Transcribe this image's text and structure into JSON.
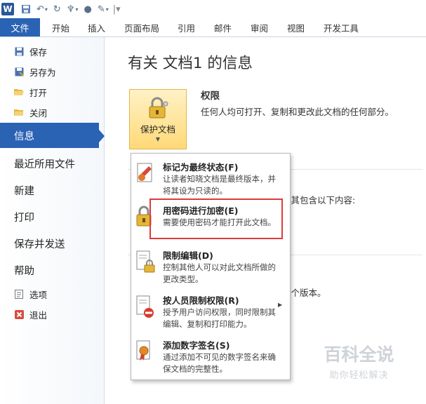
{
  "app": {
    "logo_letter": "W"
  },
  "quick_access": {
    "icons": [
      "save-icon",
      "undo-icon",
      "redo-icon",
      "format-painter-icon",
      "bullet-icon",
      "draw-icon",
      "customize-icon"
    ]
  },
  "ribbon": {
    "file_tab": "文件",
    "tabs": [
      "开始",
      "插入",
      "页面布局",
      "引用",
      "邮件",
      "审阅",
      "视图",
      "开发工具"
    ]
  },
  "sidebar": {
    "save": "保存",
    "save_as": "另存为",
    "open": "打开",
    "close": "关闭",
    "info": "信息",
    "recent": "最近所用文件",
    "new": "新建",
    "print": "打印",
    "save_send": "保存并发送",
    "help": "帮助",
    "options": "选项",
    "exit": "退出"
  },
  "main": {
    "title": "有关 文档1 的信息",
    "protect_button": "保护文档",
    "permissions_title": "权限",
    "permissions_desc": "任何人均可打开、复制和更改此文档的任何部分。",
    "partial_text_1": "意其包含以下内容:",
    "partial_text_2": "一个版本。"
  },
  "protect_menu": {
    "items": [
      {
        "title": "标记为最终状态(F)",
        "desc": "让读者知晓文档是最终版本，并将其设为只读的。"
      },
      {
        "title": "用密码进行加密(E)",
        "desc": "需要使用密码才能打开此文档。"
      },
      {
        "title": "限制编辑(D)",
        "desc": "控制其他人可以对此文档所做的更改类型。"
      },
      {
        "title": "按人员限制权限(R)",
        "desc": "授予用户访问权限，同时限制其编辑、复制和打印能力。"
      },
      {
        "title": "添加数字签名(S)",
        "desc": "通过添加不可见的数字签名来确保文档的完整性。"
      }
    ]
  },
  "watermark": {
    "title": "百科全说",
    "subtitle": "助你轻松解决"
  },
  "colors": {
    "accent": "#2a62b4",
    "highlight": "#dd3b3b",
    "button_fill": "#ffd977"
  }
}
